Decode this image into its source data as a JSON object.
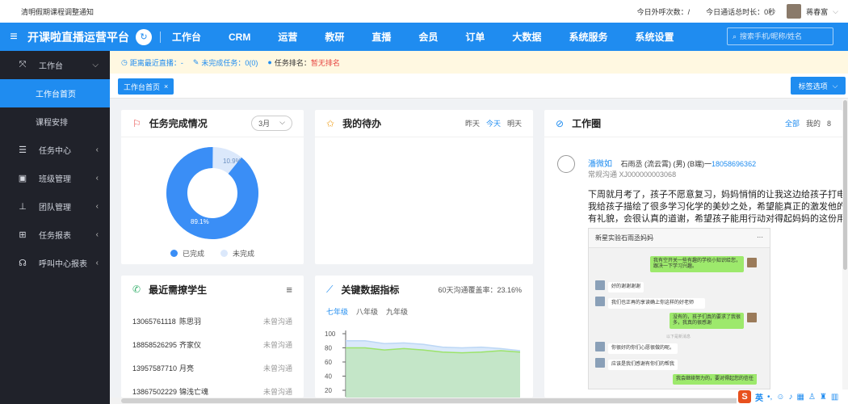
{
  "topbar": {
    "notice": "清明假期课程调整通知",
    "outbound_calls": "今日外呼次数：/",
    "call_duration": "今日通话总时长：0秒",
    "username": "蒋春富"
  },
  "navbar": {
    "brand": "开课啦直播运营平台",
    "items": [
      "工作台",
      "CRM",
      "运营",
      "教研",
      "直播",
      "会员",
      "订单",
      "大数据",
      "系统服务",
      "系统设置"
    ],
    "search_placeholder": "搜索手机/昵称/姓名"
  },
  "sidebar": {
    "workbench": "工作台",
    "home": "工作台首页",
    "schedule": "课程安排",
    "task_center": "任务中心",
    "class_mgmt": "班级管理",
    "team_mgmt": "团队管理",
    "task_report": "任务报表",
    "call_report": "呼叫中心报表"
  },
  "infobar": {
    "live": "距离最近直播：-",
    "tasks": "未完成任务：0(0)",
    "rank_label": "任务排名：",
    "rank_value": "暂无排名"
  },
  "tabs": {
    "active_tab": "工作台首页",
    "close": "×",
    "tag_options": "标签选项"
  },
  "task_card": {
    "title": "任务完成情况",
    "month": "3月",
    "completed_label": "已完成",
    "incomplete_label": "未完成",
    "completed_pct": "89.1%",
    "incomplete_pct": "10.9%",
    "completed_color": "#3a8ef6",
    "incomplete_color": "#dbe8fb"
  },
  "todo_card": {
    "title": "我的待办",
    "yesterday": "昨天",
    "today": "今天",
    "tomorrow": "明天"
  },
  "circle_card": {
    "title": "工作圈",
    "all": "全部",
    "mine": "我的",
    "more": "8",
    "user_name": "潘微如",
    "user_info": "石雨丞 (流云霄) (男) (B端)一",
    "user_phone": "18058696362",
    "sub_info": "常规沟通  XJ000000003068",
    "text_line1": "下周就月考了，孩子不愿意复习，妈妈悄悄的让我这边给孩子打电话，劝孩",
    "text_line2": "我给孩子描绘了很多学习化学的美妙之处，希望能真正的激发他的学习兴趣",
    "text_line3": "有礼貌，会很认真的道谢，希望孩子能用行动对得起妈妈的这份用心啊",
    "chat_title": "新星实验石雨丞妈妈",
    "chat_dots": "···",
    "chat_system": "以下是新消息",
    "chat_msgs": [
      "我有空开关一些有趣的学校小知识给您，跟决一下学习兴趣。",
      "好的谢谢谢谢",
      "我们也正再的享读确上你这样的好老师",
      "没有的，孩子们真的要求了我很多，我真的很感谢",
      "你很好的你们心愿很做的呢。",
      "应该是我们感谢有你们的帮我",
      "我会继续努力的，要对得起您的信任"
    ]
  },
  "students_card": {
    "title": "最近需撩学生",
    "rows": [
      {
        "phone": "13065761118",
        "name": "陈思羽",
        "status": "未曾沟通"
      },
      {
        "phone": "18858526295",
        "name": "齐家仪",
        "status": "未曾沟通"
      },
      {
        "phone": "13957587710",
        "name": "月亮",
        "status": "未曾沟通"
      },
      {
        "phone": "13867502229",
        "name": "锦浅亡魂",
        "status": "未曾沟通"
      }
    ]
  },
  "kpi_card": {
    "title": "关键数据指标",
    "coverage": "60天沟通覆盖率：23.16%",
    "grades": [
      "七年级",
      "八年级",
      "九年级"
    ]
  },
  "chart_data": {
    "type": "area",
    "title": "",
    "y_ticks": [
      "100",
      "80",
      "60",
      "40",
      "20"
    ],
    "ylim": [
      20,
      100
    ],
    "series": [
      {
        "values": [
          90,
          90,
          86,
          87,
          85,
          81,
          80,
          81,
          79,
          76
        ]
      },
      {
        "values": [
          80,
          80,
          77,
          79,
          77,
          74,
          73,
          74,
          76,
          74
        ]
      }
    ],
    "colors": [
      "#bcd7f5",
      "#9ce36a"
    ]
  },
  "ime": {
    "logo": "S",
    "lang": "英"
  }
}
